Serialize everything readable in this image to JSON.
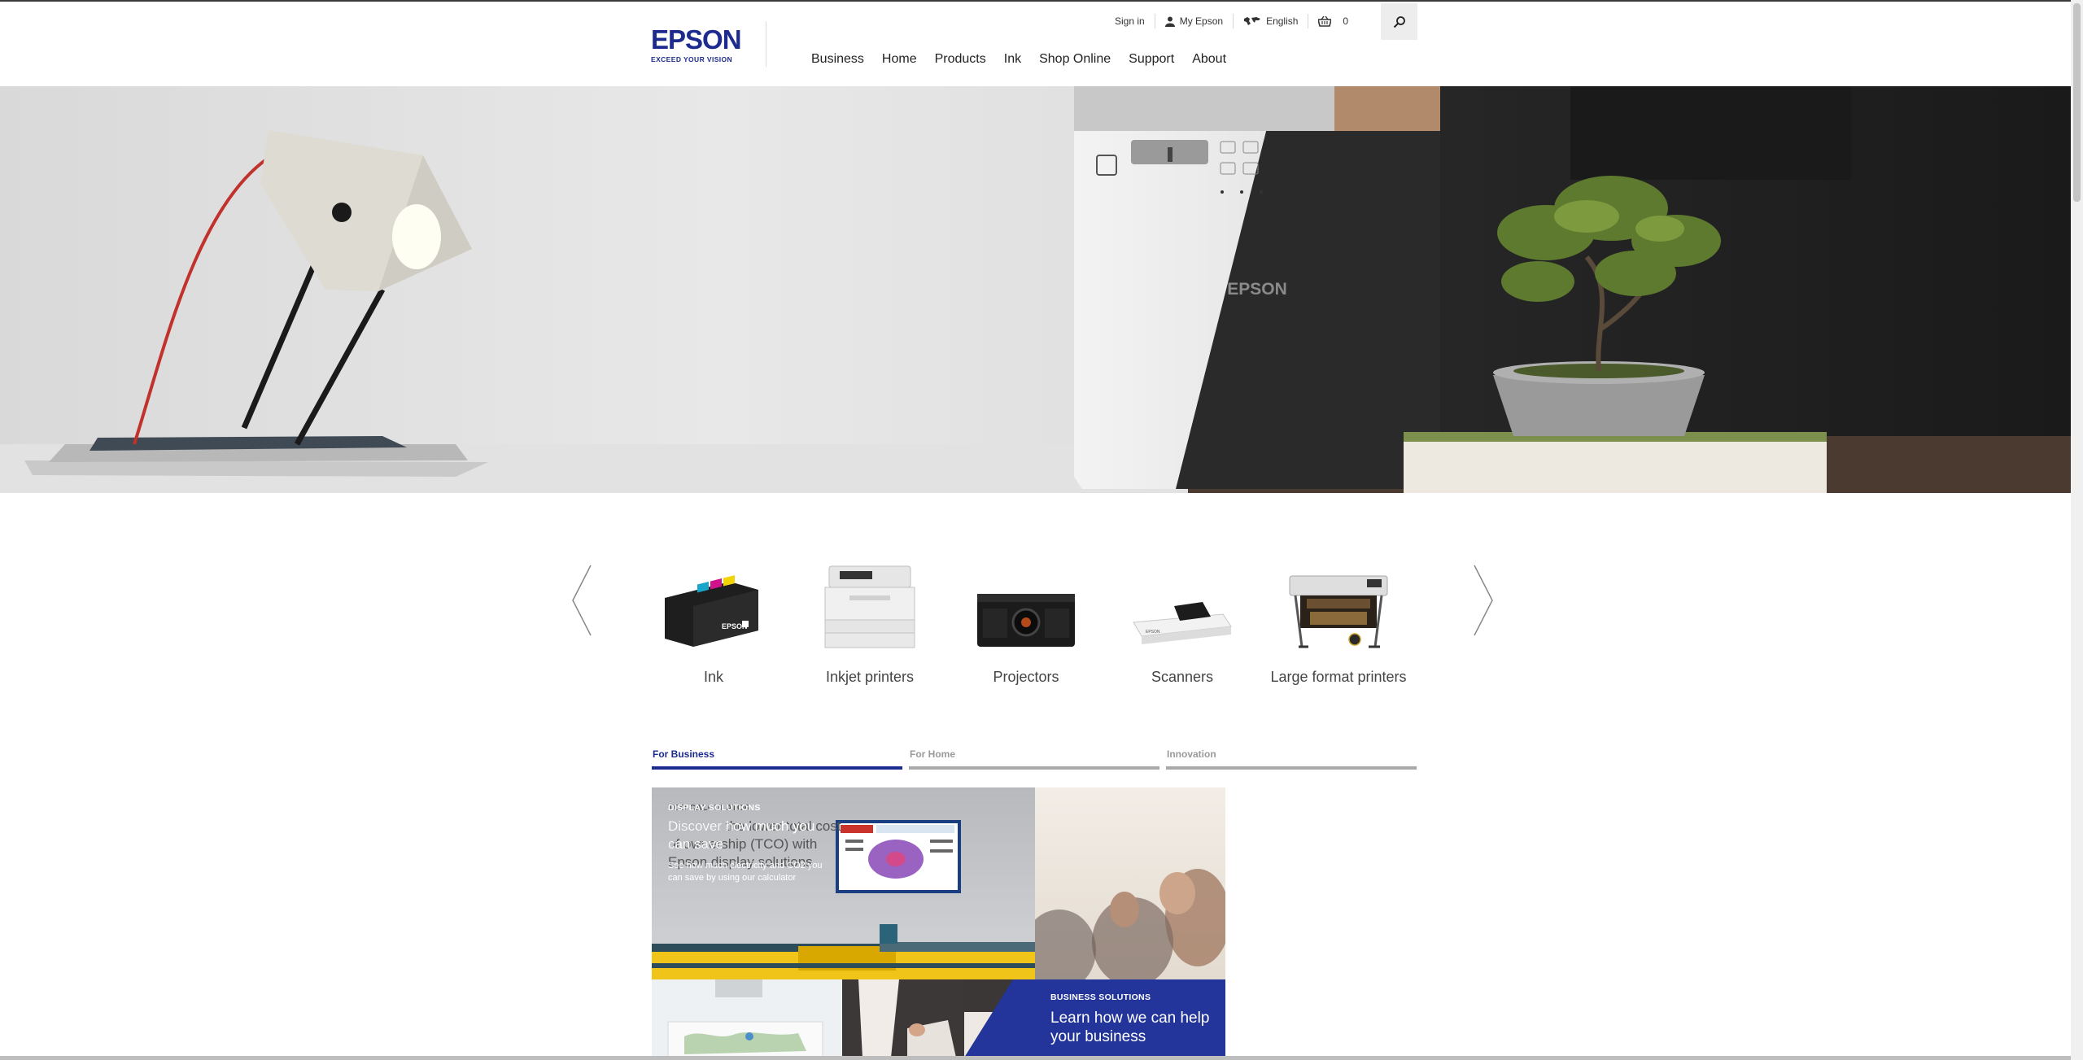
{
  "header": {
    "logo": {
      "word": "EPSON",
      "sub": "EXCEED YOUR VISION"
    },
    "util": {
      "sign_in": "Sign in",
      "my_epson": "My Epson",
      "language": "English",
      "cart_count": "0"
    },
    "nav": [
      "Business",
      "Home",
      "Products",
      "Ink",
      "Shop Online",
      "Support",
      "About"
    ]
  },
  "hero": {
    "brand_on_device": "EPSON"
  },
  "categories": [
    {
      "label": "Ink",
      "icon": "ink-cartridges-icon"
    },
    {
      "label": "Inkjet printers",
      "icon": "inkjet-printer-icon"
    },
    {
      "label": "Projectors",
      "icon": "projector-icon"
    },
    {
      "label": "Scanners",
      "icon": "scanner-icon"
    },
    {
      "label": "Large format printers",
      "icon": "large-format-printer-icon"
    }
  ],
  "tabs": [
    {
      "label": "For Business",
      "active": true
    },
    {
      "label": "For Home",
      "active": false
    },
    {
      "label": "Innovation",
      "active": false
    }
  ],
  "tiles": {
    "main": {
      "kicker_front": "DISPLAY SOLUTIONS",
      "kicker_back": "TCO CALCULATOR",
      "heading_front": "Discover how much you can save",
      "heading_back": "Discover the lower total cost of ownership (TCO) with Epson display solutions",
      "body": "See how much electricity and CO2 you can save by using our calculator"
    },
    "business": {
      "kicker": "BUSINESS SOLUTIONS",
      "heading": "Learn how we can help your business"
    }
  },
  "colors": {
    "brand": "#1d2b8f",
    "tab_active": "#1d2b8f",
    "tab_inactive": "#a9a9a9",
    "tile_blue": "#23359a"
  }
}
